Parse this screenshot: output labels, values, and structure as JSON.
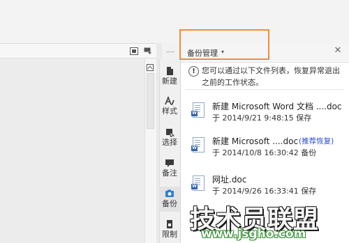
{
  "colors": {
    "highlight": "#f08c3a",
    "recover_link": "#2a4fd0",
    "watermark_green": "#2d8c2d"
  },
  "pane": {
    "title": "备份管理",
    "dropdown_icon": "chevron-down-icon",
    "close_icon": "close-icon",
    "message": "您可以通过以下文件列表，恢复异常退出之前的工作状态。",
    "files": [
      {
        "name": "新建 Microsoft Word 文档 ....doc",
        "meta": "于 2014/9/21 9:48:15 保存",
        "tag": ""
      },
      {
        "name": "新建 Microsoft ....doc",
        "meta": "于 2014/10/8 16:30:42 备份",
        "tag": "(推荐恢复)"
      },
      {
        "name": "网址.doc",
        "meta": "于 2014/9/26 16:33:41 保存",
        "tag": ""
      }
    ]
  },
  "toolstrip": {
    "items": [
      {
        "label": "新建",
        "icon": "new-doc-icon"
      },
      {
        "label": "样式",
        "icon": "style-icon"
      },
      {
        "label": "选择",
        "icon": "select-icon"
      },
      {
        "label": "备注",
        "icon": "comment-icon"
      },
      {
        "label": "备份",
        "icon": "backup-icon"
      },
      {
        "label": "限制",
        "icon": "restrict-icon"
      }
    ]
  },
  "watermark": {
    "line1": "技术员联盟",
    "line2": "www.jsgho.com"
  }
}
